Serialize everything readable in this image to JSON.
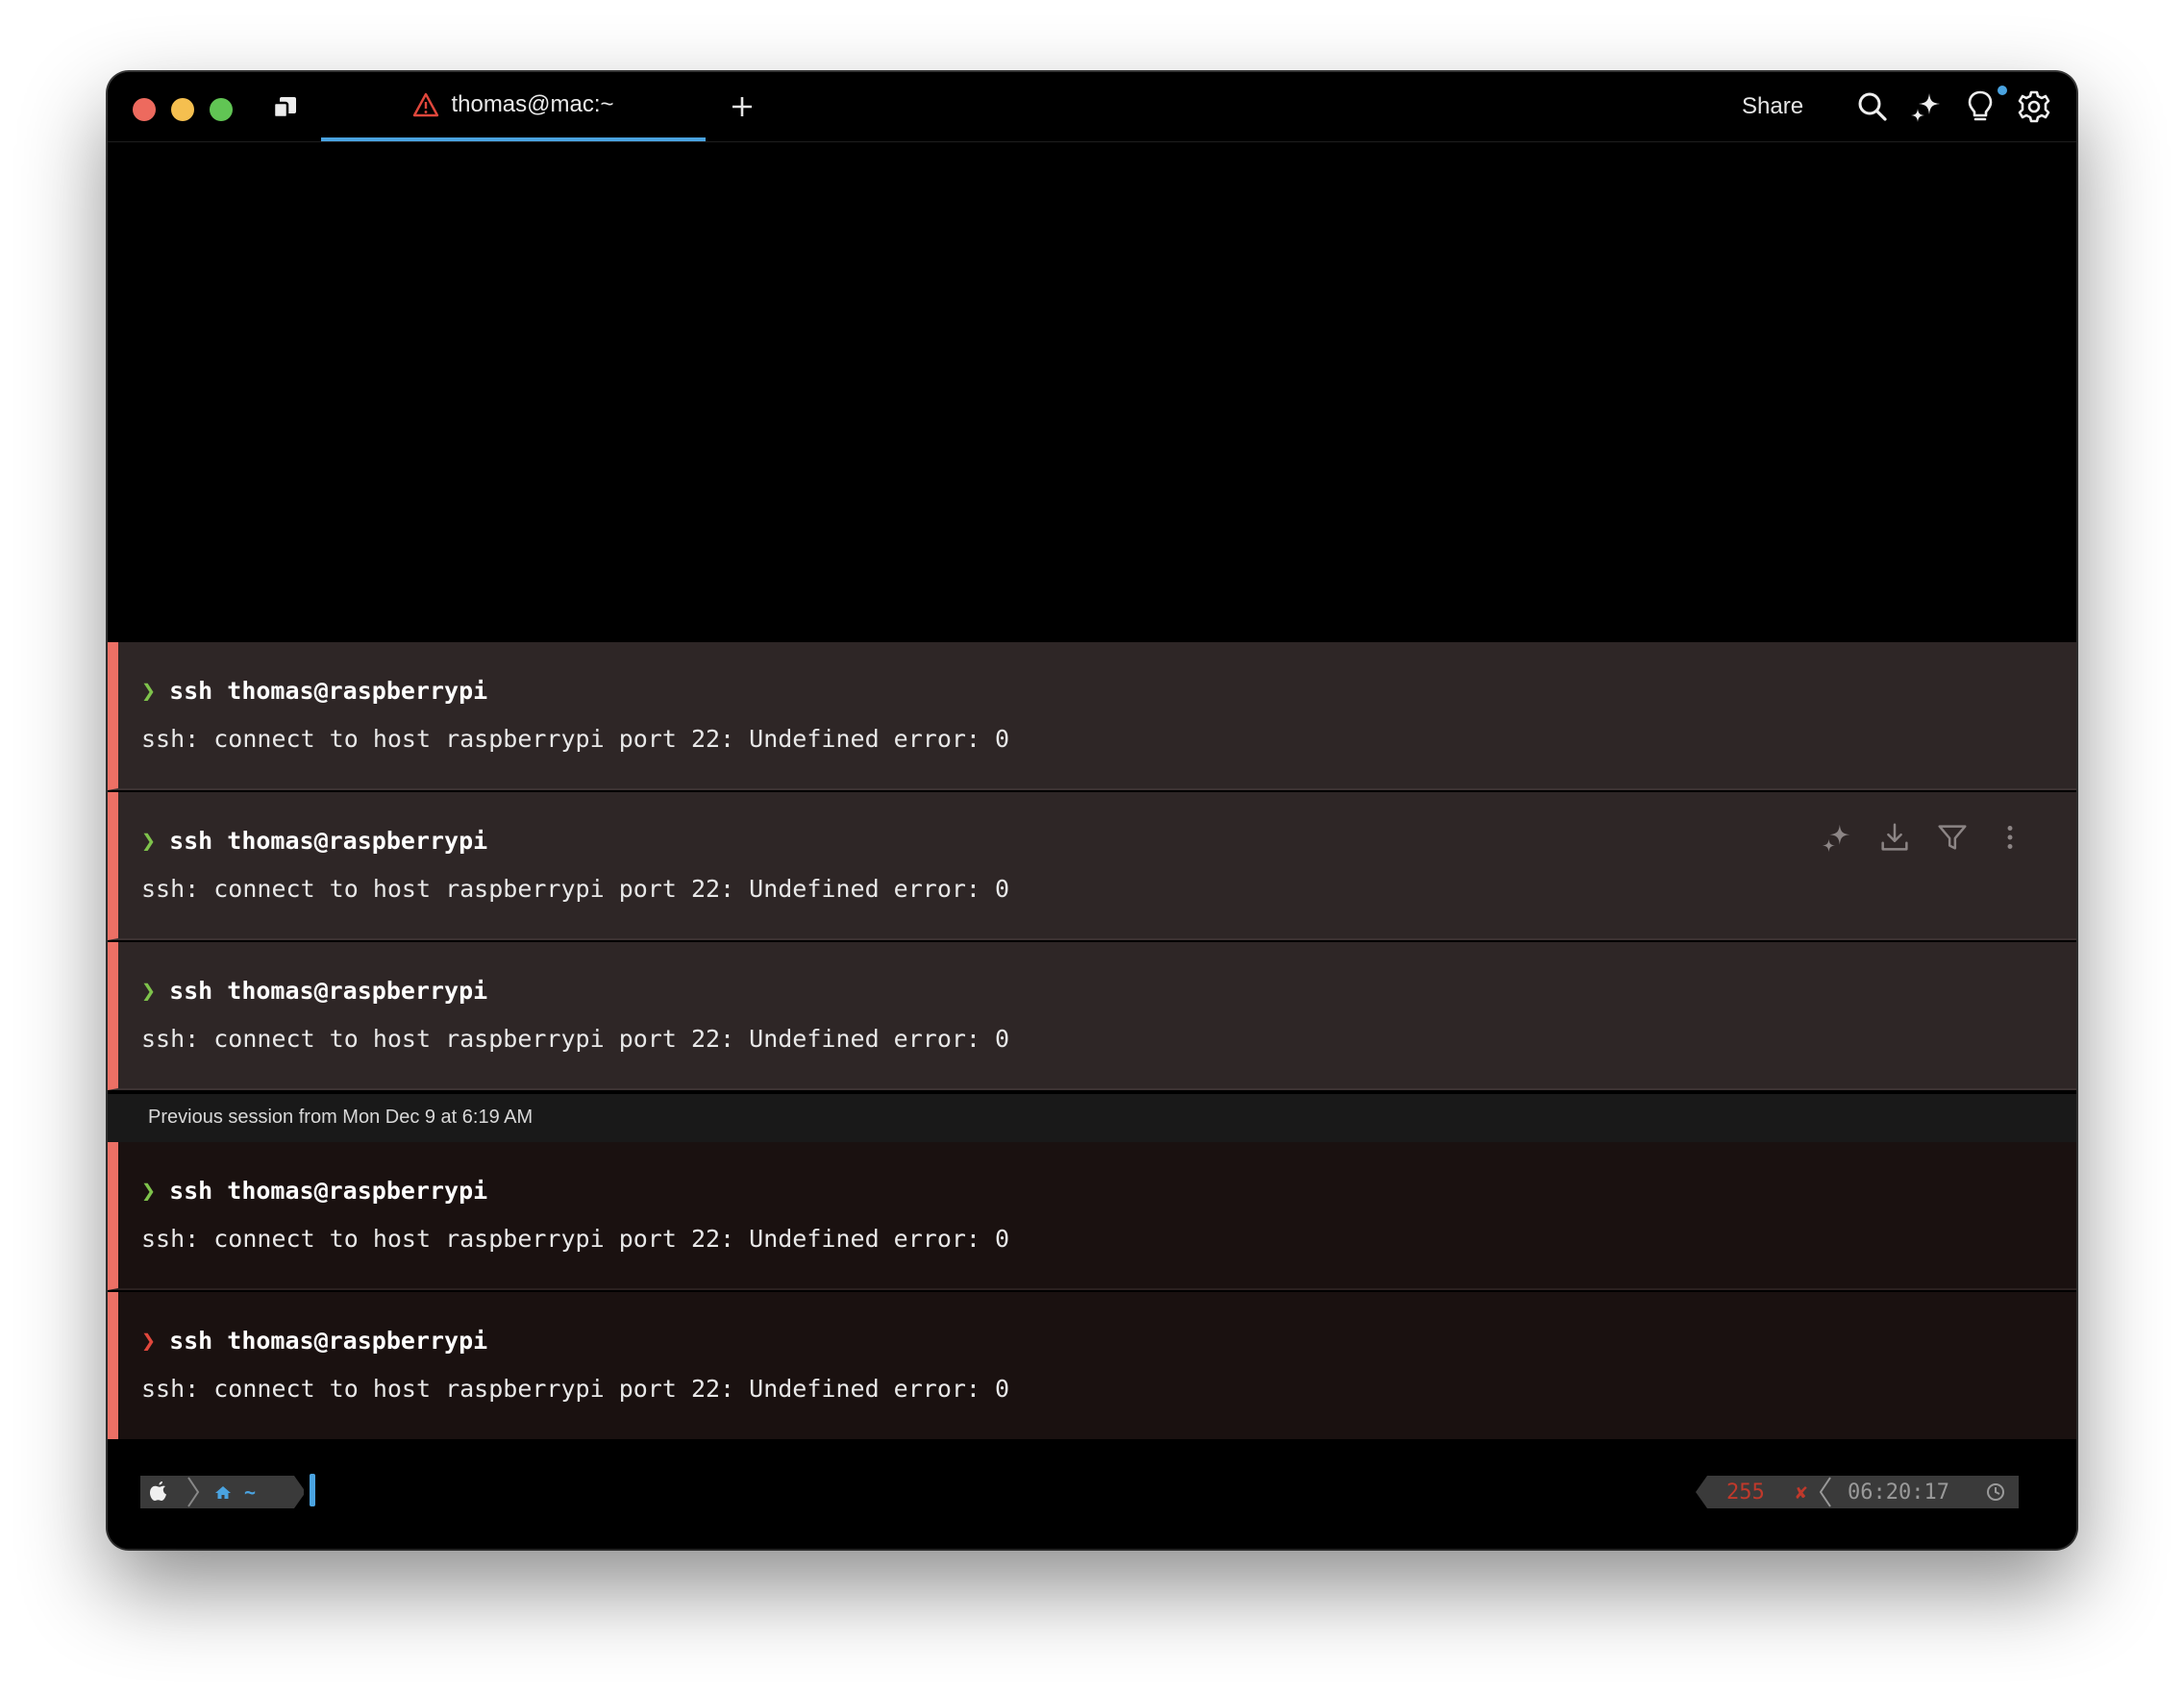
{
  "titlebar": {
    "tab_title": "thomas@mac:~",
    "share_label": "Share"
  },
  "blocks": [
    {
      "command": "ssh thomas@raspberrypi",
      "output": "ssh: connect to host raspberrypi port 22: Undefined error: 0",
      "prompt_color": "green"
    },
    {
      "command": "ssh thomas@raspberrypi",
      "output": "ssh: connect to host raspberrypi port 22: Undefined error: 0",
      "prompt_color": "green"
    },
    {
      "command": "ssh thomas@raspberrypi",
      "output": "ssh: connect to host raspberrypi port 22: Undefined error: 0",
      "prompt_color": "green"
    },
    {
      "command": "ssh thomas@raspberrypi",
      "output": "ssh: connect to host raspberrypi port 22: Undefined error: 0",
      "prompt_color": "green"
    },
    {
      "command": "ssh thomas@raspberrypi",
      "output": "ssh: connect to host raspberrypi port 22: Undefined error: 0",
      "prompt_color": "red"
    }
  ],
  "session_divider": "Previous session from Mon Dec 9 at 6:19 AM",
  "prompt": {
    "cwd": "~",
    "exit_code": "255",
    "exit_mark": "✘",
    "time": "06:20:17"
  },
  "icons": {
    "tab_status": "warning-triangle-icon",
    "block_actions": [
      "ai-sparkle-icon",
      "download-icon",
      "filter-icon",
      "more-vertical-icon"
    ]
  },
  "colors": {
    "accent": "#4aa3e0",
    "error_bar": "#ec7065",
    "prompt_green": "#7ec24b",
    "prompt_red": "#e0473c",
    "error_code": "#c0392b"
  }
}
